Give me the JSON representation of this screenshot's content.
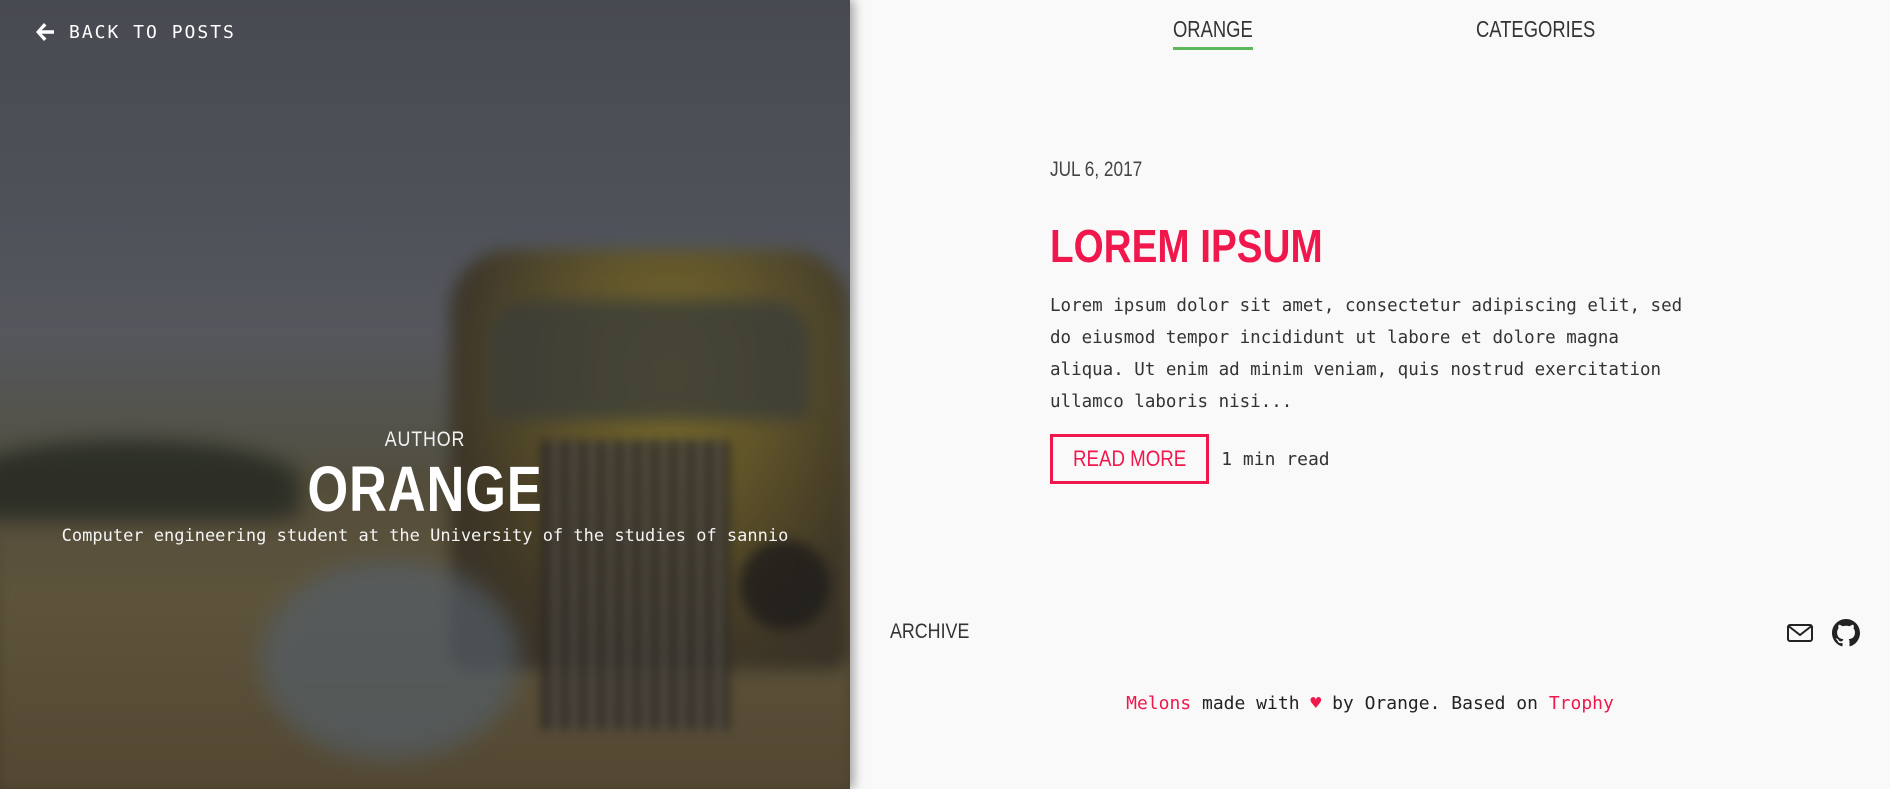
{
  "hero": {
    "back_label": "BACK TO POSTS",
    "author_label": "AUTHOR",
    "author_name": "ORANGE",
    "author_bio": "Computer engineering student at the University of the studies of sannio"
  },
  "nav": {
    "items": [
      {
        "label": "ORANGE",
        "active": true
      },
      {
        "label": "CATEGORIES",
        "active": false
      }
    ],
    "active_underline_color": "#5cb85c"
  },
  "post": {
    "date": "JUL 6, 2017",
    "title": "LOREM IPSUM",
    "excerpt": "Lorem ipsum dolor sit amet, consectetur adipiscing elit, sed do eiusmod tempor incididunt ut labore et dolore magna aliqua. Ut enim ad minim veniam, quis nostrud exercitation ullamco laboris nisi...",
    "read_more_label": "READ MORE",
    "read_time": "1 min read"
  },
  "archive_label": "ARCHIVE",
  "social": {
    "icons": [
      "mail-icon",
      "github-icon"
    ]
  },
  "footer": {
    "site_link": "Melons",
    "made_with": "made with",
    "heart": "♥",
    "by_text": "by Orange. Based on",
    "theme_link": "Trophy"
  },
  "colors": {
    "accent": "#f0174c",
    "nav_active": "#5cb85c",
    "background": "#f9f9f9",
    "text": "#333333"
  }
}
